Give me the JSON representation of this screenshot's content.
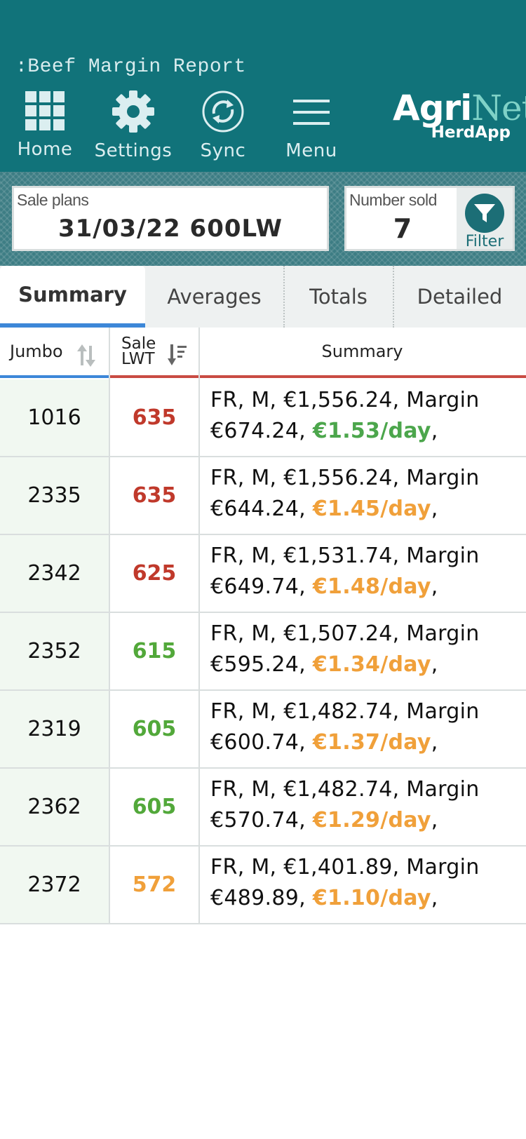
{
  "header": {
    "title": ":Beef Margin Report",
    "nav": [
      {
        "label": "Home",
        "icon": "grid-icon"
      },
      {
        "label": "Settings",
        "icon": "gear-icon"
      },
      {
        "label": "Sync",
        "icon": "sync-icon"
      },
      {
        "label": "Menu",
        "icon": "hamburger-icon"
      }
    ],
    "logo": {
      "main_a": "Agri",
      "main_b": "Net",
      "sub": "HerdApp"
    }
  },
  "controls": {
    "sale_plans_label": "Sale plans",
    "sale_plans_value": "31/03/22 600LW",
    "number_sold_label": "Number sold",
    "number_sold_value": "7",
    "filter_label": "Filter"
  },
  "tabs": [
    {
      "label": "Summary",
      "active": true
    },
    {
      "label": "Averages",
      "active": false
    },
    {
      "label": "Totals",
      "active": false
    },
    {
      "label": "Detailed",
      "active": false
    }
  ],
  "table": {
    "columns": {
      "jumbo": "Jumbo",
      "sale_line1": "Sale",
      "sale_line2": "LWT",
      "summary": "Summary"
    },
    "rows": [
      {
        "jumbo": "1016",
        "lwt": "635",
        "lwt_color": "#c0392b",
        "line1": "FR, M, €1,556.24, Margin",
        "line2a": "€674.24, ",
        "rate": "€1.53/day",
        "rate_color": "#4ca64c",
        "line2b": ","
      },
      {
        "jumbo": "2335",
        "lwt": "635",
        "lwt_color": "#c0392b",
        "line1": "FR, M, €1,556.24, Margin",
        "line2a": "€644.24, ",
        "rate": "€1.45/day",
        "rate_color": "#f0a03a",
        "line2b": ","
      },
      {
        "jumbo": "2342",
        "lwt": "625",
        "lwt_color": "#c0392b",
        "line1": "FR, M, €1,531.74, Margin",
        "line2a": "€649.74, ",
        "rate": "€1.48/day",
        "rate_color": "#f0a03a",
        "line2b": ","
      },
      {
        "jumbo": "2352",
        "lwt": "615",
        "lwt_color": "#52a83a",
        "line1": "FR, M, €1,507.24, Margin",
        "line2a": "€595.24, ",
        "rate": "€1.34/day",
        "rate_color": "#f0a03a",
        "line2b": ","
      },
      {
        "jumbo": "2319",
        "lwt": "605",
        "lwt_color": "#52a83a",
        "line1": "FR, M, €1,482.74, Margin",
        "line2a": "€600.74, ",
        "rate": "€1.37/day",
        "rate_color": "#f0a03a",
        "line2b": ","
      },
      {
        "jumbo": "2362",
        "lwt": "605",
        "lwt_color": "#52a83a",
        "line1": "FR, M, €1,482.74, Margin",
        "line2a": "€570.74, ",
        "rate": "€1.29/day",
        "rate_color": "#f0a03a",
        "line2b": ","
      },
      {
        "jumbo": "2372",
        "lwt": "572",
        "lwt_color": "#f0a03a",
        "line1": "FR, M, €1,401.89, Margin",
        "line2a": "€489.89, ",
        "rate": "€1.10/day",
        "rate_color": "#f0a03a",
        "line2b": ","
      }
    ]
  }
}
